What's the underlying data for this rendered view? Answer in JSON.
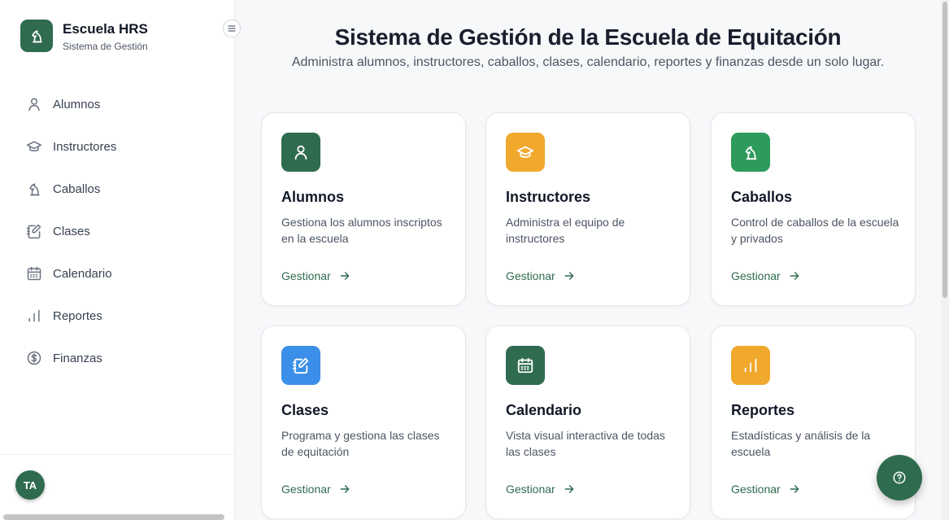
{
  "brand": {
    "title": "Escuela HRS",
    "subtitle": "Sistema de Gestión",
    "icon": "horse-icon"
  },
  "sidebar": {
    "items": [
      {
        "label": "Alumnos",
        "icon": "user-icon"
      },
      {
        "label": "Instructores",
        "icon": "graduation-cap-icon"
      },
      {
        "label": "Caballos",
        "icon": "horse-icon"
      },
      {
        "label": "Clases",
        "icon": "notebook-pen-icon"
      },
      {
        "label": "Calendario",
        "icon": "calendar-icon"
      },
      {
        "label": "Reportes",
        "icon": "bar-chart-icon"
      },
      {
        "label": "Finanzas",
        "icon": "dollar-circle-icon"
      }
    ],
    "user_initials": "TA"
  },
  "main": {
    "title": "Sistema de Gestión de la Escuela de Equitación",
    "subtitle": "Administra alumnos, instructores, caballos, clases, calendario, reportes y finanzas desde un solo lugar.",
    "cards": [
      {
        "title": "Alumnos",
        "description": "Gestiona los alumnos inscriptos en la escuela",
        "link": "Gestionar",
        "color": "#2f6b4f",
        "icon": "user-icon"
      },
      {
        "title": "Instructores",
        "description": "Administra el equipo de instructores",
        "link": "Gestionar",
        "color": "#f0a92d",
        "icon": "graduation-cap-icon"
      },
      {
        "title": "Caballos",
        "description": "Control de caballos de la escuela y privados",
        "link": "Gestionar",
        "color": "#2e9a5c",
        "icon": "horse-icon"
      },
      {
        "title": "Clases",
        "description": "Programa y gestiona las clases de equitación",
        "link": "Gestionar",
        "color": "#3b8fe8",
        "icon": "notebook-pen-icon"
      },
      {
        "title": "Calendario",
        "description": "Vista visual interactiva de todas las clases",
        "link": "Gestionar",
        "color": "#2f6b4f",
        "icon": "calendar-icon"
      },
      {
        "title": "Reportes",
        "description": "Estadísticas y análisis de la escuela",
        "link": "Gestionar",
        "color": "#f0a92d",
        "icon": "bar-chart-icon"
      }
    ]
  },
  "colors": {
    "primary": "#2f6b4f",
    "accent_orange": "#f0a92d",
    "accent_green": "#2e9a5c",
    "accent_blue": "#3b8fe8"
  }
}
